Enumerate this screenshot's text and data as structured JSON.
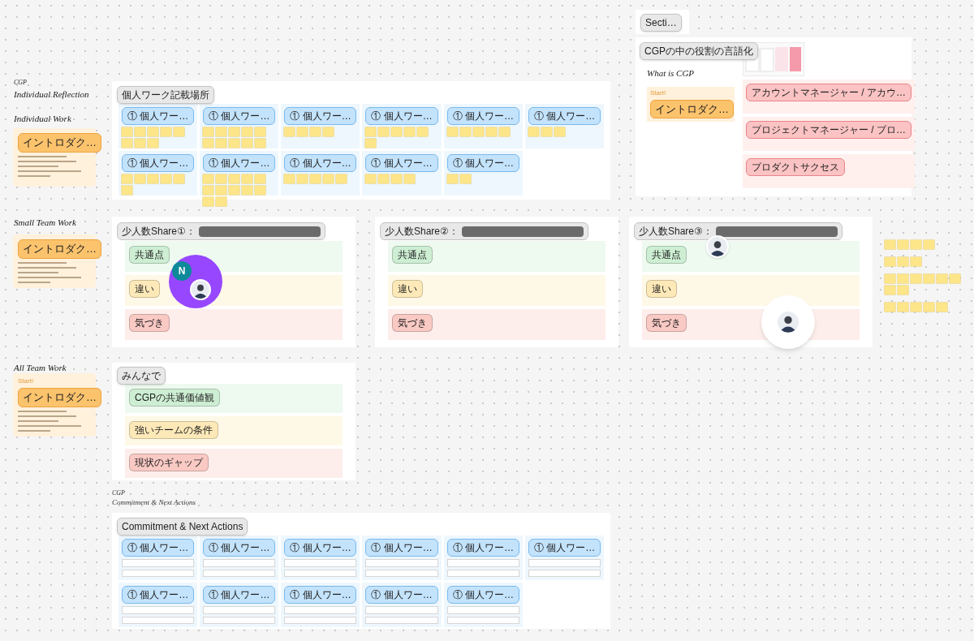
{
  "side_headings": [
    {
      "kind": "caption",
      "text": "CGP"
    },
    {
      "kind": "title",
      "text": "Individual Reflection"
    },
    {
      "kind": "title",
      "text": "Individual Work"
    },
    {
      "kind": "title",
      "text": "Small Team Work"
    },
    {
      "kind": "title",
      "text": "All Team Work"
    }
  ],
  "intro_cards": [
    {
      "tag": "イントロダク…"
    },
    {
      "tag": "イントロダク…"
    },
    {
      "caption": "Start!",
      "tag": "イントロダク…"
    }
  ],
  "individual_work": {
    "label": "個人ワーク記載場所",
    "cards": [
      "① 個人ワー…",
      "① 個人ワー…",
      "① 個人ワー…",
      "① 個人ワー…",
      "① 個人ワー…",
      "① 個人ワー…",
      "① 個人ワー…",
      "① 個人ワー…",
      "① 個人ワー…",
      "① 個人ワー…",
      "① 個人ワー…"
    ]
  },
  "section_stub": {
    "label": "Secti…"
  },
  "cgp_roles": {
    "label": "CGPの中の役割の言語化",
    "heading": "What is CGP",
    "intro": {
      "caption": "Start!",
      "tag": "イントロダク…"
    },
    "rows": [
      "アカウントマネージャー / アカウ…",
      "プロジェクトマネージャー / プロ…",
      "プロダクトサクセス"
    ]
  },
  "share_panels": [
    {
      "label": "少人数Share①",
      "separator": "：",
      "rows": [
        {
          "tag": "共通点",
          "color": "#cdeed3"
        },
        {
          "tag": "違い",
          "color": "#fde9b8"
        },
        {
          "tag": "気づき",
          "color": "#f9c9c4"
        }
      ]
    },
    {
      "label": "少人数Share②",
      "separator": "：",
      "rows": [
        {
          "tag": "共通点",
          "color": "#cdeed3"
        },
        {
          "tag": "違い",
          "color": "#fde9b8"
        },
        {
          "tag": "気づき",
          "color": "#f9c9c4"
        }
      ]
    },
    {
      "label": "少人数Share③",
      "separator": "：",
      "rows": [
        {
          "tag": "共通点",
          "color": "#cdeed3"
        },
        {
          "tag": "違い",
          "color": "#fde9b8"
        },
        {
          "tag": "気づき",
          "color": "#f9c9c4"
        }
      ]
    }
  ],
  "all_team": {
    "label": "みんなで",
    "rows": [
      {
        "tag": "CGPの共通価値観",
        "color": "#cdeed3"
      },
      {
        "tag": "強いチームの条件",
        "color": "#fde9b8"
      },
      {
        "tag": "現状のギャップ",
        "color": "#f9c9c4"
      }
    ]
  },
  "commitment": {
    "caption_small": "CGP",
    "caption": "Commitment & Next Actions",
    "label": "Commitment & Next Actions",
    "cards": [
      "① 個人ワー…",
      "① 個人ワー…",
      "① 個人ワー…",
      "① 個人ワー…",
      "① 個人ワー…",
      "① 個人ワー…",
      "① 個人ワー…",
      "① 個人ワー…",
      "① 個人ワー…",
      "① 個人ワー…",
      "① 個人ワー…"
    ]
  },
  "cursor_badge": {
    "initial": "N"
  }
}
